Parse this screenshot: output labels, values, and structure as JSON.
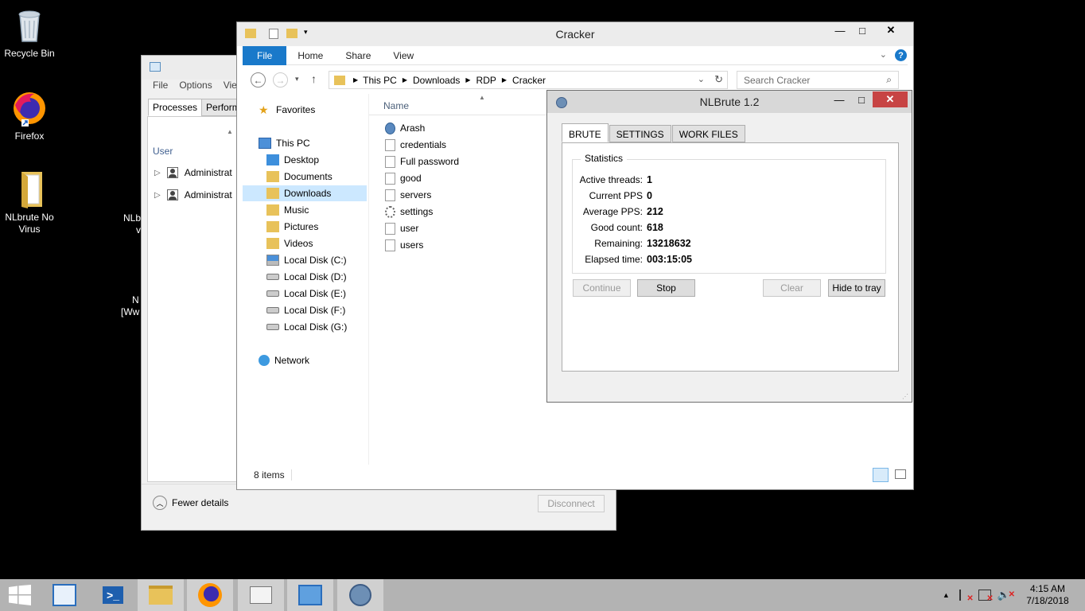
{
  "desktop": {
    "icons": [
      {
        "label": "Recycle Bin",
        "icon": "recycle-bin-icon"
      },
      {
        "label": "Firefox",
        "icon": "firefox-icon"
      },
      {
        "label": "NLbrute No Virus",
        "icon": "folder-icon"
      }
    ],
    "partial_labels": [
      "NLb",
      "v",
      "N",
      "[Ww"
    ]
  },
  "taskmgr": {
    "menu": [
      "File",
      "Options",
      "View"
    ],
    "tabs": [
      "Processes",
      "Perform"
    ],
    "column_user": "User",
    "rows": [
      "Administrat",
      "Administrat"
    ],
    "fewer_details": "Fewer details",
    "disconnect": "Disconnect"
  },
  "explorer": {
    "title": "Cracker",
    "ribbon_tabs": [
      "File",
      "Home",
      "Share",
      "View"
    ],
    "breadcrumb": [
      "This PC",
      "Downloads",
      "RDP",
      "Cracker"
    ],
    "search_placeholder": "Search Cracker",
    "nav": {
      "favorites": "Favorites",
      "this_pc": "This PC",
      "items": [
        "Desktop",
        "Documents",
        "Downloads",
        "Music",
        "Pictures",
        "Videos",
        "Local Disk (C:)",
        "Local Disk (D:)",
        "Local Disk (E:)",
        "Local Disk (F:)",
        "Local Disk (G:)"
      ],
      "network": "Network",
      "selected": "Downloads"
    },
    "column_name": "Name",
    "files": [
      "Arash",
      "credentials",
      "Full password",
      "good",
      "servers",
      "settings",
      "user",
      "users"
    ],
    "status": "8 items"
  },
  "nlbrute": {
    "title": "NLBrute 1.2",
    "tabs": [
      "BRUTE",
      "SETTINGS",
      "WORK FILES"
    ],
    "group_title": "Statistics",
    "stats": [
      {
        "label": "Active threads:",
        "value": "1"
      },
      {
        "label": "Current PPS",
        "value": "0"
      },
      {
        "label": "Average PPS:",
        "value": "212"
      },
      {
        "label": "Good count:",
        "value": "618"
      },
      {
        "label": "Remaining:",
        "value": "13218632"
      },
      {
        "label": "Elapsed time:",
        "value": "003:15:05"
      }
    ],
    "buttons": {
      "continue": "Continue",
      "stop": "Stop",
      "clear": "Clear",
      "hide": "Hide to tray"
    }
  },
  "taskbar": {
    "time": "4:15 AM",
    "date": "7/18/2018"
  },
  "colors": {
    "accent": "#1979ca",
    "taskbar": "#b3b3b3",
    "selected": "#cce8ff"
  }
}
